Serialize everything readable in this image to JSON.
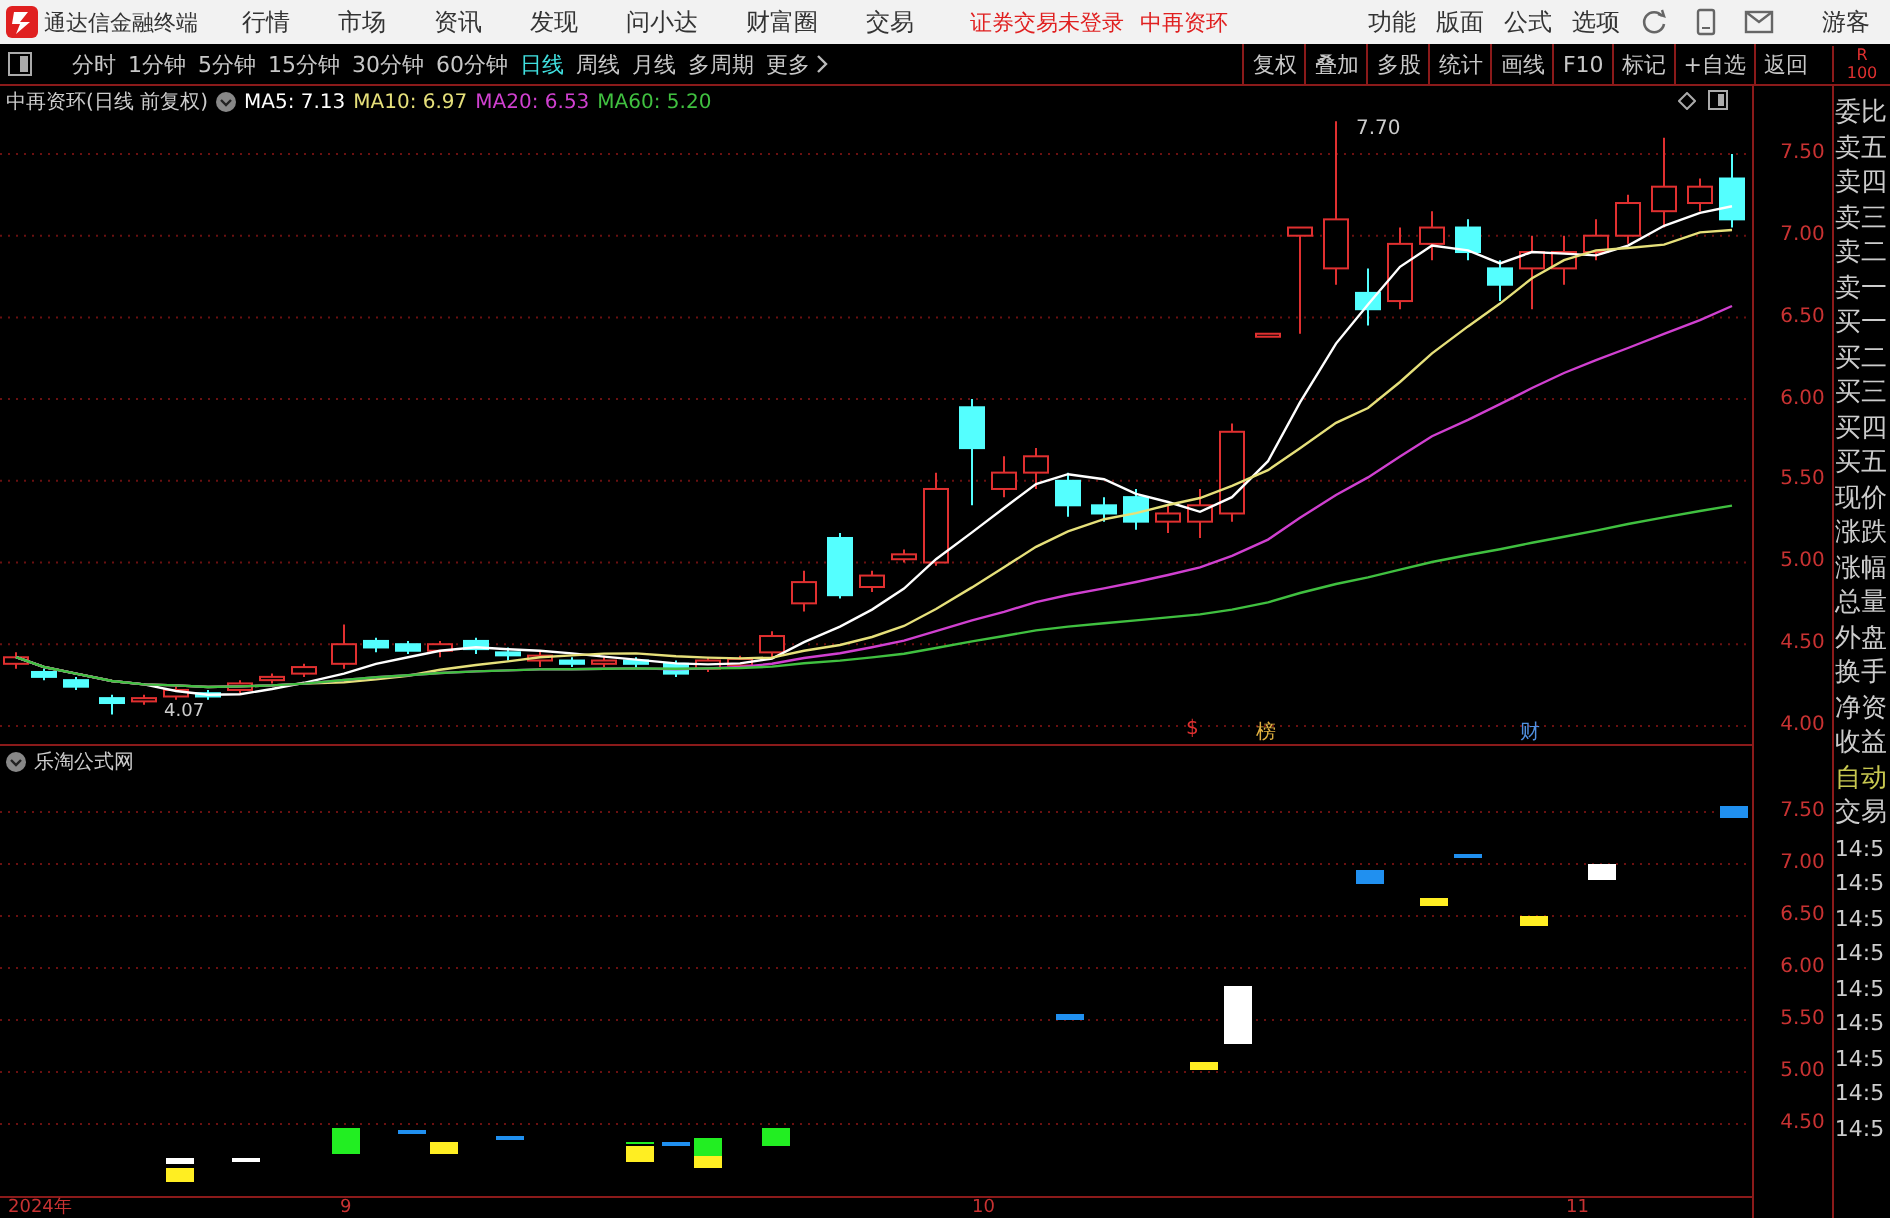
{
  "menubar": {
    "app_title": "通达信金融终端",
    "menus": [
      "行情",
      "市场",
      "资讯",
      "发现",
      "问小达",
      "财富圈",
      "交易"
    ],
    "notice": "证券交易未登录",
    "stock": "中再资环",
    "tools": [
      "功能",
      "版面",
      "公式",
      "选项"
    ],
    "user": "游客"
  },
  "toolbar": {
    "periods": [
      {
        "label": "分时",
        "selected": false
      },
      {
        "label": "1分钟",
        "selected": false
      },
      {
        "label": "5分钟",
        "selected": false
      },
      {
        "label": "15分钟",
        "selected": false
      },
      {
        "label": "30分钟",
        "selected": false
      },
      {
        "label": "60分钟",
        "selected": false
      },
      {
        "label": "日线",
        "selected": true
      },
      {
        "label": "周线",
        "selected": false
      },
      {
        "label": "月线",
        "selected": false
      },
      {
        "label": "多周期",
        "selected": false
      },
      {
        "label": "更多",
        "selected": false
      }
    ],
    "actions": [
      "复权",
      "叠加",
      "多股",
      "统计",
      "画线",
      "F10",
      "标记",
      "+自选",
      "返回"
    ],
    "corner": [
      "R",
      "100"
    ]
  },
  "chart": {
    "title": "中再资环(日线 前复权)",
    "legend": [
      {
        "label": "MA5: 7.13",
        "color": "#ffffff"
      },
      {
        "label": "MA10: 6.97",
        "color": "#e6e07a"
      },
      {
        "label": "MA20: 6.53",
        "color": "#d040d0"
      },
      {
        "label": "MA60: 5.20",
        "color": "#40c040"
      }
    ],
    "high_label": "7.70",
    "low_label": "4.07",
    "yticks": [
      "7.50",
      "7.00",
      "6.50",
      "6.00",
      "5.50",
      "5.00",
      "4.50",
      "4.00"
    ],
    "markers": [
      {
        "text": "$",
        "color": "#e03030"
      },
      {
        "text": "榜",
        "color": "#e0b040"
      },
      {
        "text": "财",
        "color": "#5090e0"
      }
    ]
  },
  "indicator": {
    "title": "乐淘公式网",
    "yticks": [
      "7.50",
      "7.00",
      "6.50",
      "6.00",
      "5.50",
      "5.00",
      "4.50"
    ]
  },
  "dates": [
    "2024年",
    "9",
    "10",
    "11"
  ],
  "side_panel": [
    {
      "text": "委比",
      "kind": "label"
    },
    {
      "text": "卖五",
      "kind": "label"
    },
    {
      "text": "卖四",
      "kind": "label"
    },
    {
      "text": "卖三",
      "kind": "label"
    },
    {
      "text": "卖二",
      "kind": "label"
    },
    {
      "text": "卖一",
      "kind": "label"
    },
    {
      "text": "买一",
      "kind": "label"
    },
    {
      "text": "买二",
      "kind": "label"
    },
    {
      "text": "买三",
      "kind": "label"
    },
    {
      "text": "买四",
      "kind": "label"
    },
    {
      "text": "买五",
      "kind": "label"
    },
    {
      "text": "现价",
      "kind": "label"
    },
    {
      "text": "涨跌",
      "kind": "label"
    },
    {
      "text": "涨幅",
      "kind": "label"
    },
    {
      "text": "总量",
      "kind": "label"
    },
    {
      "text": "外盘",
      "kind": "label"
    },
    {
      "text": "换手",
      "kind": "label"
    },
    {
      "text": "净资",
      "kind": "label"
    },
    {
      "text": "收益",
      "kind": "label"
    },
    {
      "text": "自动",
      "kind": "highlight"
    },
    {
      "text": "交易",
      "kind": "label"
    },
    {
      "text": "14:5",
      "kind": "time"
    },
    {
      "text": "14:5",
      "kind": "time"
    },
    {
      "text": "14:5",
      "kind": "time"
    },
    {
      "text": "14:5",
      "kind": "time"
    },
    {
      "text": "14:5",
      "kind": "time"
    },
    {
      "text": "14:5",
      "kind": "time"
    },
    {
      "text": "14:5",
      "kind": "time"
    },
    {
      "text": "14:5",
      "kind": "time"
    },
    {
      "text": "14:5",
      "kind": "time"
    }
  ]
}
